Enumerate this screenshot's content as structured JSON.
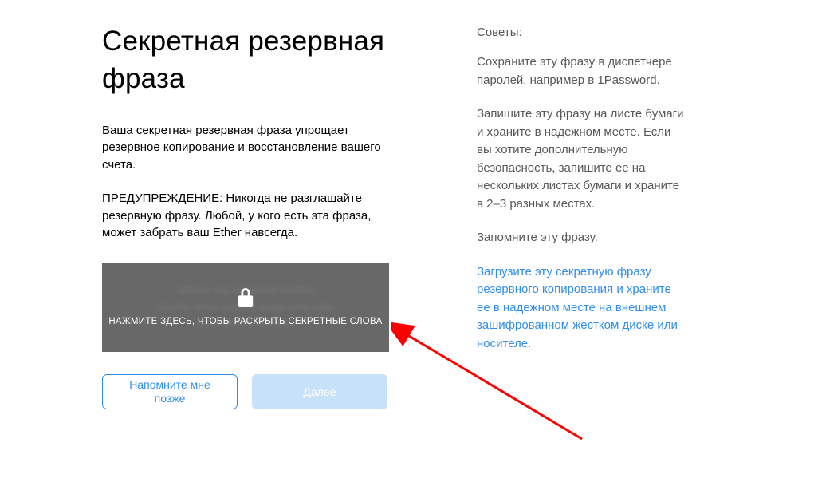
{
  "left": {
    "title": "Секретная резервная фраза",
    "description": "Ваша секретная резервная фраза упрощает резервное копирование и восстановление вашего счета.",
    "warning": "ПРЕДУПРЕЖДЕНИЕ: Никогда не разглашайте резервную фразу. Любой, у кого есть эта фраза, может забрать ваш Ether навсегда.",
    "reveal_label": "НАЖМИТЕ ЗДЕСЬ, ЧТОБЫ РАСКРЫТЬ СЕКРЕТНЫЕ СЛОВА",
    "blurred_placeholder_1": "nobody ring list speed monkey",
    "blurred_placeholder_2": "favorite ticket cushion siege work palm",
    "blurred_placeholder_3": "settle eternal pyramid"
  },
  "buttons": {
    "remind_later": "Напомните мне позже",
    "next": "Далее"
  },
  "tips": {
    "heading": "Советы:",
    "tip1": "Сохраните эту фразу в диспетчере паролей, например в 1Password.",
    "tip2": "Запишите эту фразу на листе бумаги и храните в надежном месте. Если вы хотите дополнительную безопасность, запишите ее на нескольких листах бумаги и храните в 2–3 разных местах.",
    "tip3": "Запомните эту фразу.",
    "download_link": "Загрузите эту секретную фразу резервного копирования и храните ее в надежном месте на внешнем зашифрованном жестком диске или носителе."
  }
}
